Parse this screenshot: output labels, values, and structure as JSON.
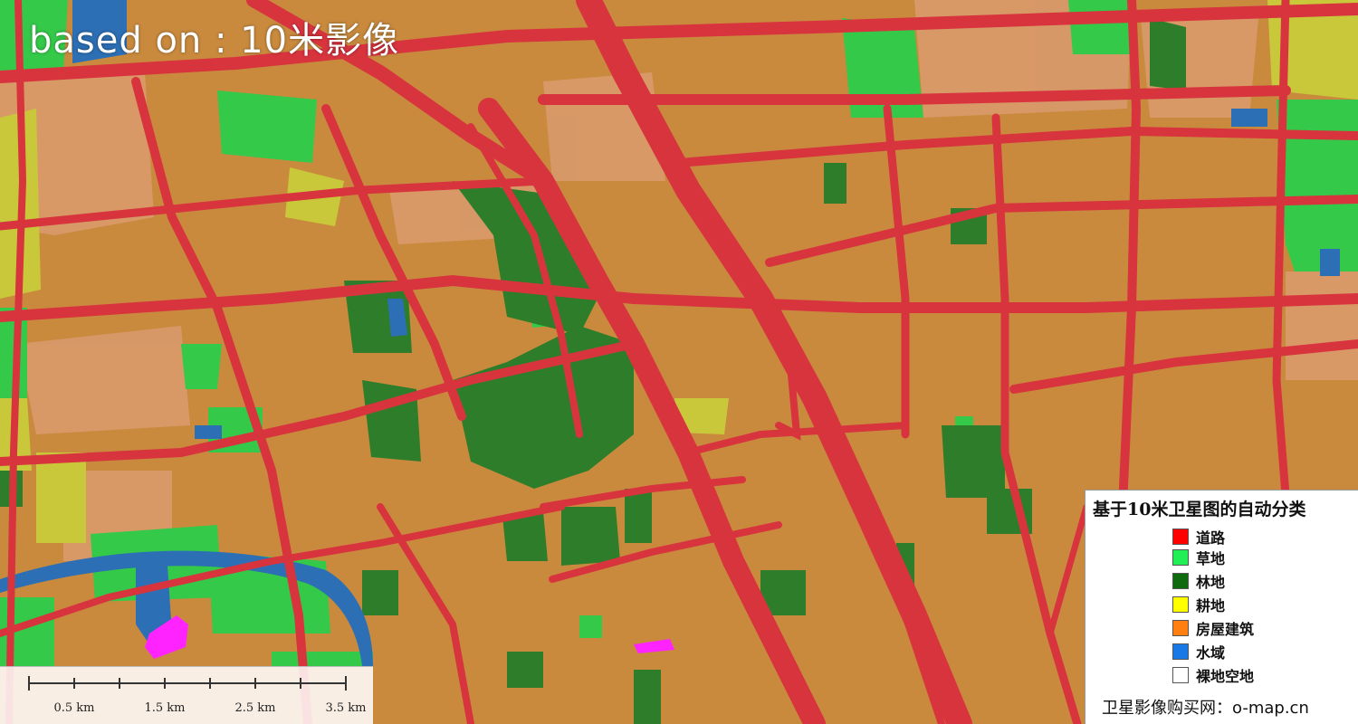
{
  "map": {
    "overlay_title": "based on : 10米影像",
    "colors": {
      "building": "#c98a3e",
      "building_light": "#d9a06a",
      "road": "#d8343e",
      "grass": "#35c94a",
      "forest": "#2e7d2a",
      "farmland": "#c9c83a",
      "water": "#2c6fb4",
      "bare": "#e0a8b8",
      "magenta": "#ff24ff"
    }
  },
  "legend": {
    "title": "基于10米卫星图的自动分类",
    "items": [
      {
        "label": "道路",
        "color": "#ff0000"
      },
      {
        "label": "草地",
        "color": "#22ee55"
      },
      {
        "label": "林地",
        "color": "#0f6a10"
      },
      {
        "label": "耕地",
        "color": "#ffff00"
      },
      {
        "label": "房屋建筑",
        "color": "#ff7f10"
      },
      {
        "label": "水域",
        "color": "#1a78e6"
      },
      {
        "label": "裸地空地",
        "color": "#ffffff"
      }
    ],
    "footer": "卫星影像购买网：o-map.cn"
  },
  "scalebar": {
    "labels": [
      "0.5 km",
      "1.5 km",
      "2.5 km",
      "3.5 km"
    ]
  }
}
